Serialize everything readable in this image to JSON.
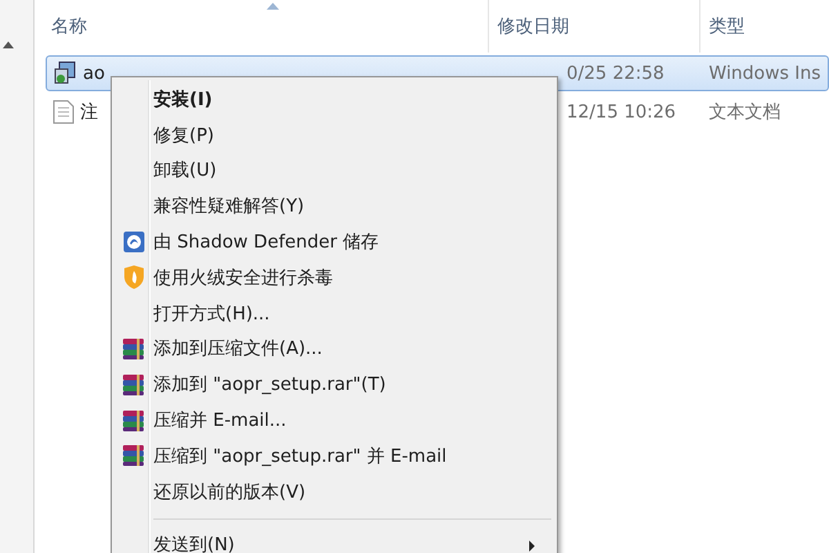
{
  "columns": [
    {
      "label": "名称",
      "sorted": true
    },
    {
      "label": "修改日期",
      "sorted": false
    },
    {
      "label": "类型",
      "sorted": false
    }
  ],
  "files": [
    {
      "kind": "installer",
      "name": "ao",
      "date": "0/25 22:58",
      "type": "Windows Ins",
      "selected": true
    },
    {
      "kind": "text",
      "name": "注",
      "date": "12/15 10:26",
      "type": "文本文档",
      "selected": false
    }
  ],
  "context_menu": [
    {
      "kind": "plain",
      "label": "安装(I)",
      "bold": true,
      "submenu": false
    },
    {
      "kind": "plain",
      "label": "修复(P)",
      "bold": false,
      "submenu": false
    },
    {
      "kind": "plain",
      "label": "卸载(U)",
      "bold": false,
      "submenu": false
    },
    {
      "kind": "plain",
      "label": "兼容性疑难解答(Y)",
      "bold": false,
      "submenu": false
    },
    {
      "kind": "shadow",
      "label": "由 Shadow Defender 储存",
      "bold": false,
      "submenu": false
    },
    {
      "kind": "shield",
      "label": "使用火绒安全进行杀毒",
      "bold": false,
      "submenu": false
    },
    {
      "kind": "plain",
      "label": "打开方式(H)...",
      "bold": false,
      "submenu": false
    },
    {
      "kind": "archive",
      "label": "添加到压缩文件(A)...",
      "bold": false,
      "submenu": false
    },
    {
      "kind": "archive",
      "label": "添加到 \"aopr_setup.rar\"(T)",
      "bold": false,
      "submenu": false
    },
    {
      "kind": "archive",
      "label": "压缩并 E-mail...",
      "bold": false,
      "submenu": false
    },
    {
      "kind": "archive",
      "label": "压缩到 \"aopr_setup.rar\" 并 E-mail",
      "bold": false,
      "submenu": false
    },
    {
      "kind": "plain",
      "label": "还原以前的版本(V)",
      "bold": false,
      "submenu": false
    },
    {
      "kind": "separator"
    },
    {
      "kind": "plain",
      "label": "发送到(N)",
      "bold": false,
      "submenu": true
    }
  ]
}
